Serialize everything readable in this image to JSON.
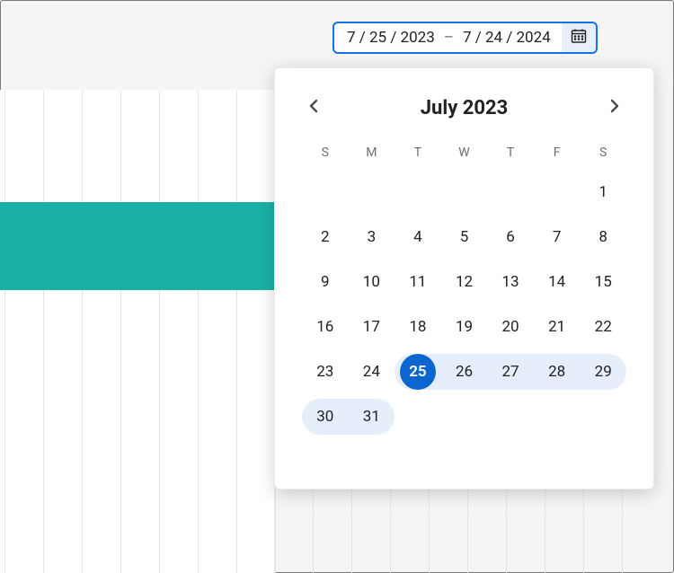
{
  "dateRange": {
    "start": "7 / 25 / 2023",
    "separator": "–",
    "end": "7 / 24 / 2024"
  },
  "calendar": {
    "title": "July 2023",
    "dow": [
      "S",
      "M",
      "T",
      "W",
      "T",
      "F",
      "S"
    ],
    "startDay": 25,
    "days": [
      [
        "",
        "",
        "",
        "",
        "",
        "",
        "1"
      ],
      [
        "2",
        "3",
        "4",
        "5",
        "6",
        "7",
        "8"
      ],
      [
        "9",
        "10",
        "11",
        "12",
        "13",
        "14",
        "15"
      ],
      [
        "16",
        "17",
        "18",
        "19",
        "20",
        "21",
        "22"
      ],
      [
        "23",
        "24",
        "25",
        "26",
        "27",
        "28",
        "29"
      ],
      [
        "30",
        "31",
        "",
        "",
        "",
        "",
        ""
      ]
    ]
  },
  "chart_data": {
    "type": "bar",
    "note": "Only a cropped fragment of a chart is visible (a single teal bar segment over faint gridlines). No axes, labels, or values are legible, so no numeric data can be read from the image."
  }
}
